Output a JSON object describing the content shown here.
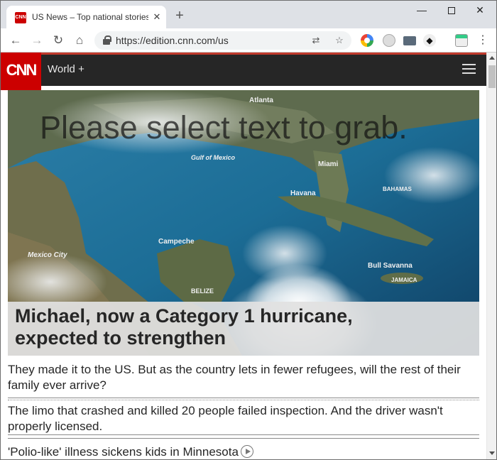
{
  "browser": {
    "tab_title": "US News – Top national stories",
    "tab_favicon_text": "CNN",
    "url": "https://edition.cnn.com/us",
    "window_controls": {
      "minimize": "—",
      "close": "✕"
    }
  },
  "site": {
    "logo_text": "CNN",
    "nav_label": "World +"
  },
  "hero": {
    "overlay_message": "Please select text to grab.",
    "headline": "Michael, now a Category 1 hurricane, expected to strengthen",
    "map_labels": [
      "Atlanta",
      "Gulf of Mexico",
      "Miami",
      "Havana",
      "Campeche",
      "Mexico City",
      "BELIZE",
      "Bull Savanna",
      "JAMAICA",
      "BAHAMAS"
    ]
  },
  "stories": [
    {
      "text": "They made it to the US. But as the country lets in fewer refugees, will the rest of their family ever arrive?"
    },
    {
      "text": "The limo that crashed and killed 20 people failed inspection. And the driver wasn't properly licensed."
    },
    {
      "text": "'Polio-like' illness sickens kids in Minnesota",
      "icon": "play-circle-icon"
    }
  ],
  "colors": {
    "cnn_red": "#cc0000",
    "header_bg": "#262626",
    "accent": "#c0392b"
  }
}
